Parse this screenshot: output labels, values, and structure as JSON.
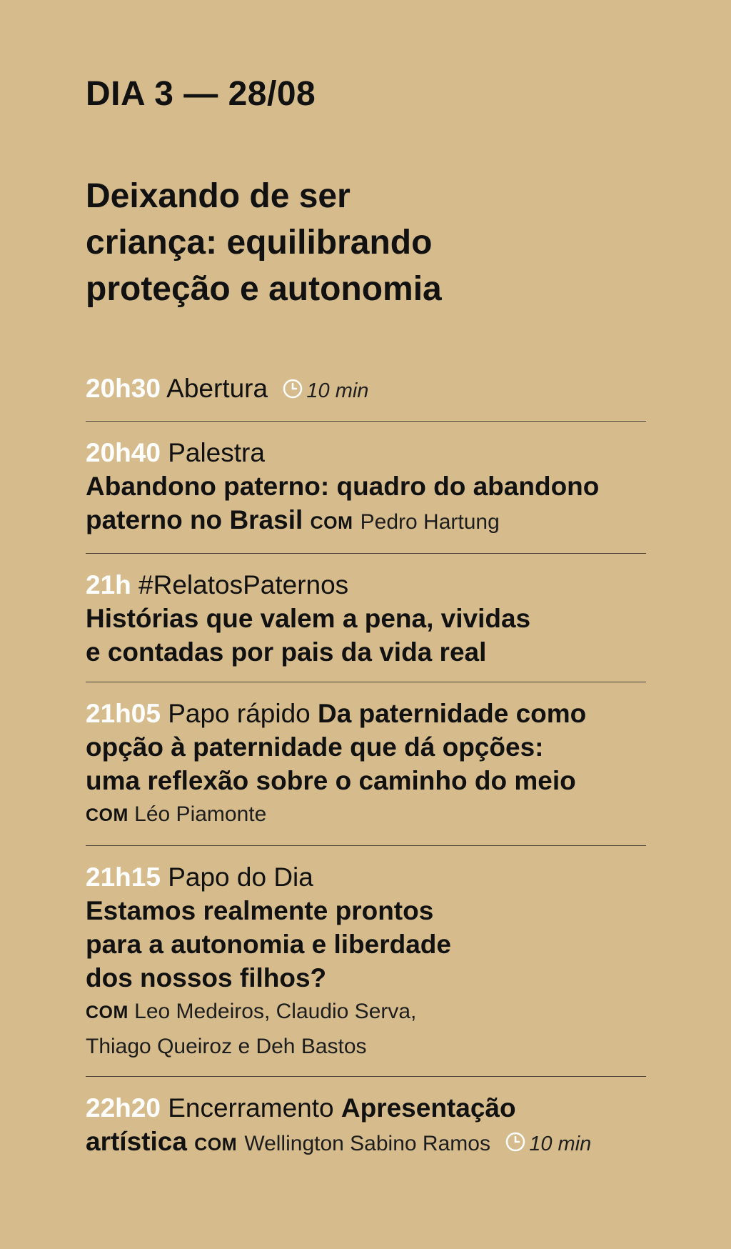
{
  "day_heading": "DIA 3 — 28/08",
  "day_title_lines": [
    "Deixando de ser",
    "criança: equilibrando",
    "proteção e autonomia"
  ],
  "com_label": "com",
  "items": [
    {
      "time": "20h30",
      "kind": "Abertura",
      "duration": "10 min",
      "duration_icon": "clock-icon"
    },
    {
      "time": "20h40",
      "kind": "Palestra",
      "title_line1": "Abandono paterno: quadro do abandono",
      "title_line2": "paterno no Brasil",
      "speaker": "Pedro Hartung"
    },
    {
      "time": "21h",
      "kind": "#RelatosPaternos",
      "title_line1": "Histórias que valem a pena, vividas",
      "title_line2": "e contadas por pais da vida real"
    },
    {
      "time": "21h05",
      "kind": "Papo rápido",
      "title_line1": "Da paternidade como",
      "title_line2": "opção à paternidade que dá opções:",
      "title_line3": "uma reflexão sobre o caminho do meio",
      "speaker": "Léo Piamonte"
    },
    {
      "time": "21h15",
      "kind": "Papo do Dia",
      "title_line1": "Estamos realmente prontos",
      "title_line2": "para a autonomia e liberdade",
      "title_line3": "dos nossos filhos?",
      "speaker_line1": "Leo Medeiros, Claudio Serva,",
      "speaker_line2": "Thiago Queiroz e Deh Bastos"
    },
    {
      "time": "22h20",
      "kind": "Encerramento",
      "title_line1": "Apresentação",
      "title_line2": "artística",
      "speaker": "Wellington Sabino Ramos",
      "duration": "10 min",
      "duration_icon": "clock-icon"
    }
  ],
  "colors": {
    "background": "#d6bc8c",
    "time_highlight": "#ffffff",
    "text": "#111111",
    "divider": "#4a4238"
  }
}
